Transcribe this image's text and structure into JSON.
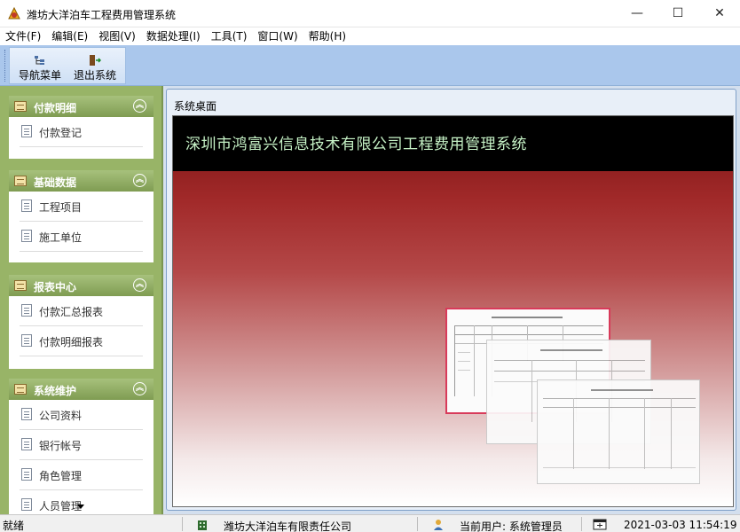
{
  "window": {
    "title": "潍坊大洋泊车工程费用管理系统",
    "minimize_glyph": "—",
    "maximize_glyph": "☐",
    "close_glyph": "✕"
  },
  "menu": [
    "文件(F)",
    "编辑(E)",
    "视图(V)",
    "数据处理(I)",
    "工具(T)",
    "窗口(W)",
    "帮助(H)"
  ],
  "toolbar": {
    "nav_label": "导航菜单",
    "exit_label": "退出系统"
  },
  "sidebar": {
    "groups": [
      {
        "title": "付款明细",
        "items": [
          "付款登记"
        ]
      },
      {
        "title": "基础数据",
        "items": [
          "工程项目",
          "施工单位"
        ]
      },
      {
        "title": "报表中心",
        "items": [
          "付款汇总报表",
          "付款明细报表"
        ]
      },
      {
        "title": "系统维护",
        "items": [
          "公司资料",
          "银行帐号",
          "角色管理",
          "人员管理"
        ]
      }
    ]
  },
  "desktop": {
    "tab_label": "系统桌面",
    "banner_title": "深圳市鸿富兴信息技术有限公司工程费用管理系统"
  },
  "statusbar": {
    "ready": "就绪",
    "company": "潍坊大洋泊车有限责任公司",
    "user": "当前用户: 系统管理员",
    "datetime": "2021-03-03 11:54:19"
  },
  "colors": {
    "toolbar_bg": "#aac7ec",
    "sidebar_bg": "#98b467",
    "group_header": "#8aa65c",
    "banner_text": "#c6f2c6",
    "doc_highlight": "#d83a5a"
  }
}
